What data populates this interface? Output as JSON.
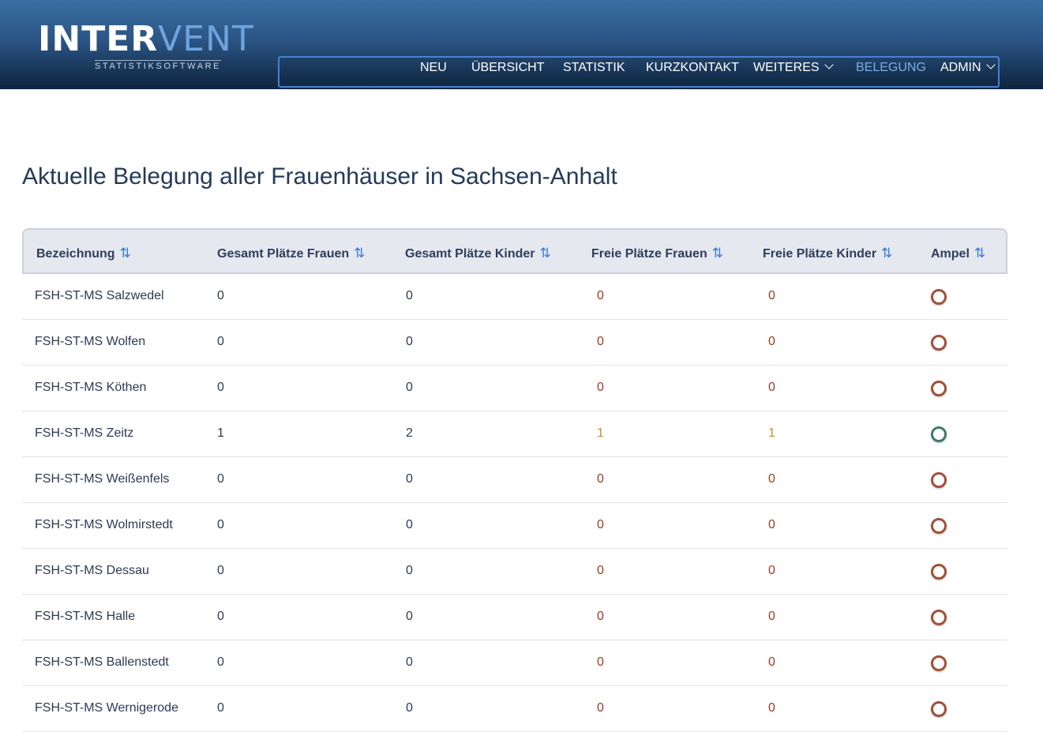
{
  "brand": {
    "logo_part1": "INTER",
    "logo_part2": "VENT",
    "tagline": "STATISTIKSOFTWARE"
  },
  "nav": {
    "items": [
      {
        "label": "NEU"
      },
      {
        "label": "ÜBERSICHT"
      },
      {
        "label": "STATISTIK"
      },
      {
        "label": "KURZKONTAKT"
      },
      {
        "label": "WEITERES",
        "dropdown": true
      },
      {
        "label": "BELEGUNG",
        "active": true
      },
      {
        "label": "ADMIN",
        "dropdown": true
      }
    ]
  },
  "page": {
    "title": "Aktuelle Belegung aller Frauenhäuser in Sachsen-Anhalt"
  },
  "table": {
    "sort_icon": "⇅",
    "headers": [
      "Bezeichnung",
      "Gesamt Plätze Frauen",
      "Gesamt Plätze Kinder",
      "Freie Plätze Frauen",
      "Freie Plätze Kinder",
      "Ampel"
    ],
    "rows": [
      {
        "name": "FSH-ST-MS Salzwedel",
        "total_women": "0",
        "total_children": "0",
        "free_women": "0",
        "free_children": "0",
        "ampel": "red"
      },
      {
        "name": "FSH-ST-MS Wolfen",
        "total_women": "0",
        "total_children": "0",
        "free_women": "0",
        "free_children": "0",
        "ampel": "red"
      },
      {
        "name": "FSH-ST-MS Köthen",
        "total_women": "0",
        "total_children": "0",
        "free_women": "0",
        "free_children": "0",
        "ampel": "red"
      },
      {
        "name": "FSH-ST-MS Zeitz",
        "total_women": "1",
        "total_children": "2",
        "free_women": "1",
        "free_children": "1",
        "ampel": "green"
      },
      {
        "name": "FSH-ST-MS Weißenfels",
        "total_women": "0",
        "total_children": "0",
        "free_women": "0",
        "free_children": "0",
        "ampel": "red"
      },
      {
        "name": "FSH-ST-MS Wolmirstedt",
        "total_women": "0",
        "total_children": "0",
        "free_women": "0",
        "free_children": "0",
        "ampel": "red"
      },
      {
        "name": "FSH-ST-MS Dessau",
        "total_women": "0",
        "total_children": "0",
        "free_women": "0",
        "free_children": "0",
        "ampel": "red"
      },
      {
        "name": "FSH-ST-MS Halle",
        "total_women": "0",
        "total_children": "0",
        "free_women": "0",
        "free_children": "0",
        "ampel": "red"
      },
      {
        "name": "FSH-ST-MS Ballenstedt",
        "total_women": "0",
        "total_children": "0",
        "free_women": "0",
        "free_children": "0",
        "ampel": "red"
      },
      {
        "name": "FSH-ST-MS Wernigerode",
        "total_women": "0",
        "total_children": "0",
        "free_women": "0",
        "free_children": "0",
        "ampel": "red"
      }
    ]
  },
  "colors": {
    "header_top": "#3a6fa3",
    "header_bottom": "#0f2440",
    "nav_active": "#79aee8",
    "free_zero": "#9a3b1d",
    "free_positive": "#b9942a",
    "ampel_red": "#a0503a",
    "ampel_green": "#3d7b6a"
  }
}
